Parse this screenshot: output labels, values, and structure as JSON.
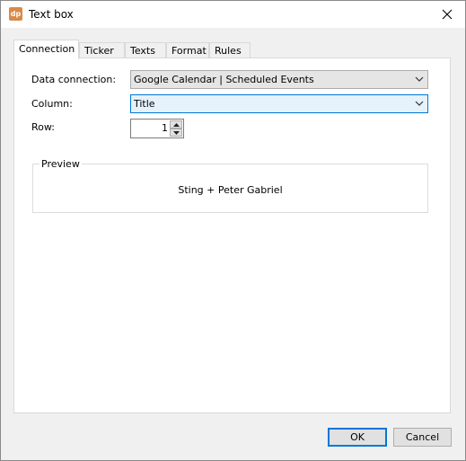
{
  "window": {
    "title": "Text box",
    "app_icon_text": "dp",
    "app_icon": "dp-logo-icon",
    "close_icon": "close-icon"
  },
  "tabs": [
    {
      "label": "Connection",
      "active": true
    },
    {
      "label": "Ticker",
      "active": false
    },
    {
      "label": "Texts",
      "active": false
    },
    {
      "label": "Format",
      "active": false
    },
    {
      "label": "Rules",
      "active": false
    }
  ],
  "form": {
    "data_connection_label": "Data connection:",
    "data_connection_value": "Google Calendar | Scheduled Events",
    "column_label": "Column:",
    "column_value": "Title",
    "row_label": "Row:",
    "row_value": "1"
  },
  "preview": {
    "legend": "Preview",
    "text": "Sting + Peter Gabriel"
  },
  "buttons": {
    "ok": "OK",
    "cancel": "Cancel"
  },
  "colors": {
    "accent": "#0078d7",
    "app_icon_bg": "#d98a4a"
  }
}
